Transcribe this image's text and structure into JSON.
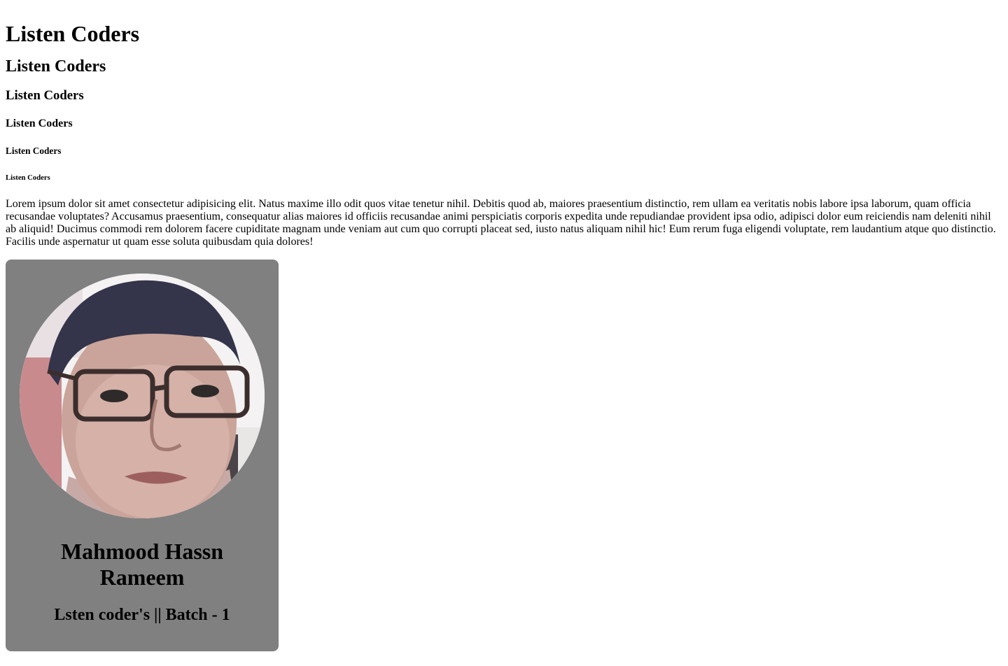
{
  "headings": {
    "h1": "Listen Coders",
    "h2": "Listen Coders",
    "h3": "Listen Coders",
    "h4": "Listen Coders",
    "h5": "Listen Coders",
    "h6": "Listen Coders"
  },
  "paragraph": "Lorem ipsum dolor sit amet consectetur adipisicing elit. Natus maxime illo odit quos vitae tenetur nihil. Debitis quod ab, maiores praesentium distinctio, rem ullam ea veritatis nobis labore ipsa laborum, quam officia recusandae voluptates? Accusamus praesentium, consequatur alias maiores id officiis recusandae animi perspiciatis corporis expedita unde repudiandae provident ipsa odio, adipisci dolor eum reiciendis nam deleniti nihil ab aliquid! Ducimus commodi rem dolorem facere cupiditate magnam unde veniam aut cum quo corrupti placeat sed, iusto natus aliquam nihil hic! Eum rerum fuga eligendi voluptate, rem laudantium atque quo distinctio. Facilis unde aspernatur ut quam esse soluta quibusdam quia dolores!",
  "card": {
    "name": "Mahmood Hassn Rameem",
    "subtitle": "Lsten coder's || Batch - 1",
    "avatar_icon": "profile-photo",
    "background_color": "#808080"
  }
}
